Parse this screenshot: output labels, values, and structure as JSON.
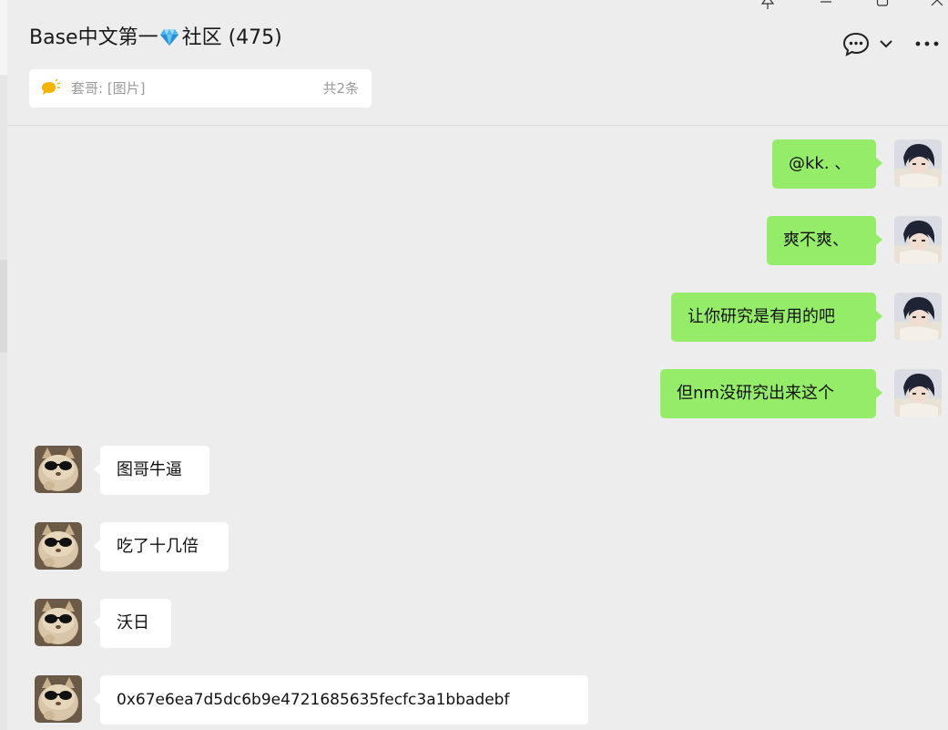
{
  "chat": {
    "title_prefix": "Base中文第一",
    "title_suffix": "社区 (475)",
    "title_emoji_icon": "gem-icon"
  },
  "notice": {
    "text": "套哥: [图片]",
    "count": "共2条",
    "icon": "announcement-icon"
  },
  "window_controls": [
    "pin-icon",
    "minimize-icon",
    "maximize-icon",
    "close-icon"
  ],
  "messages": [
    {
      "direction": "out",
      "text": "@kk. 、"
    },
    {
      "direction": "out",
      "text": "爽不爽、"
    },
    {
      "direction": "out",
      "text": "让你研究是有用的吧"
    },
    {
      "direction": "out",
      "text": "但nm没研究出来这个"
    },
    {
      "direction": "in",
      "text": "图哥牛逼"
    },
    {
      "direction": "in",
      "text": "吃了十几倍"
    },
    {
      "direction": "in",
      "text": "沃日"
    },
    {
      "direction": "in",
      "text": "0x67e6ea7d5dc6b9e4721685635fecfc3a1bbadebf"
    }
  ],
  "colors": {
    "outgoing_bubble": "#95ec69",
    "incoming_bubble": "#ffffff",
    "background": "#ededed"
  }
}
